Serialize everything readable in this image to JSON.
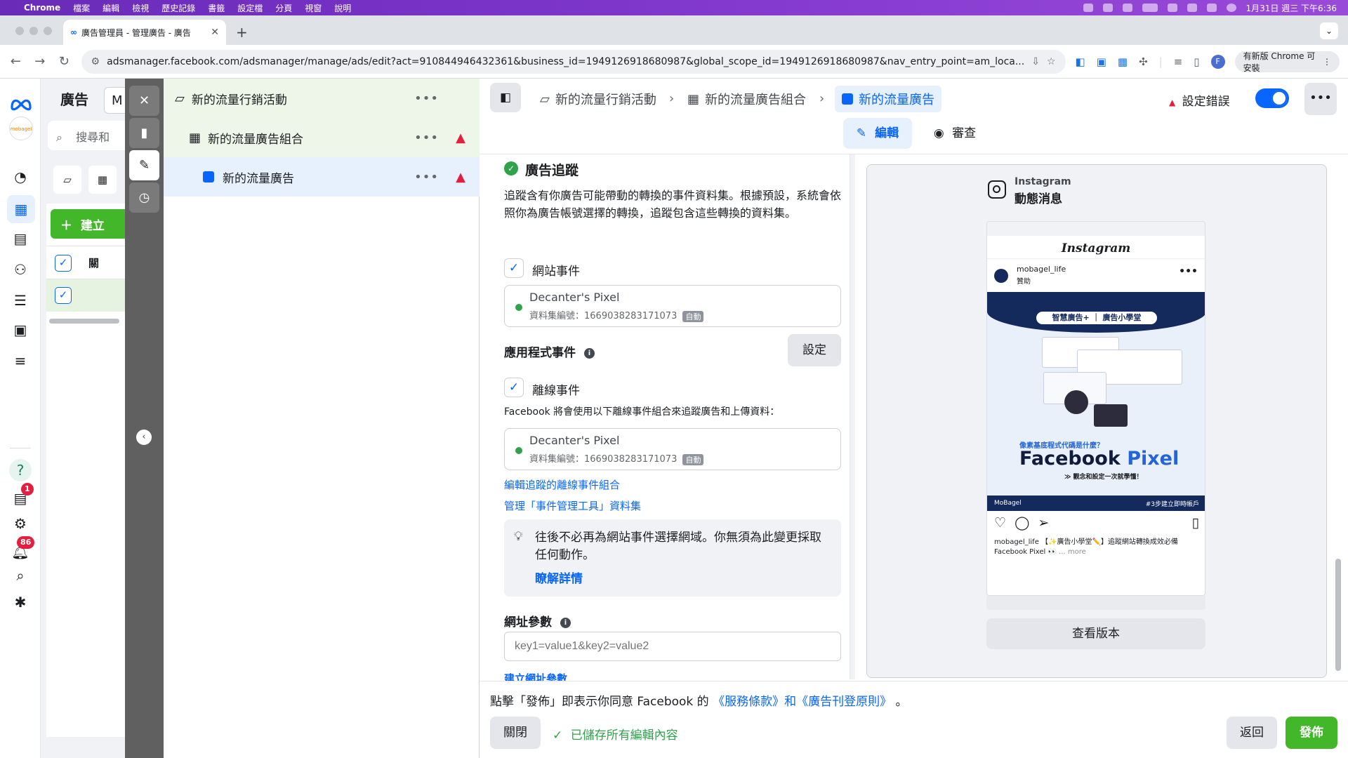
{
  "menubar": {
    "apple": "",
    "items": [
      "Chrome",
      "檔案",
      "編輯",
      "檢視",
      "歷史記錄",
      "書籤",
      "設定檔",
      "分頁",
      "視窗",
      "說明"
    ],
    "clock": "1月31日 週三 下午6:36"
  },
  "browser": {
    "tab_title": "廣告管理員 - 管理廣告 - 廣告",
    "url": "adsmanager.facebook.com/adsmanager/manage/ads/edit?act=910844946432361&business_id=1949126918680987&global_scope_id=1949126918680987&nav_entry_point=am_loca...",
    "update_label": "有新版 Chrome 可安裝",
    "profile_initial": "F"
  },
  "rail": {
    "help_glyph": "?",
    "notif_badge": "1",
    "alerts_badge": "86"
  },
  "under": {
    "title": "廣告",
    "search_placeholder": "搜尋和",
    "create_label": "建立",
    "col_header": "關",
    "partial_select": "M"
  },
  "tree": {
    "campaign": "新的流量行銷活動",
    "adset": "新的流量廣告組合",
    "ad": "新的流量廣告"
  },
  "header": {
    "crumb_campaign": "新的流量行銷活動",
    "crumb_adset": "新的流量廣告組合",
    "crumb_ad": "新的流量廣告",
    "error_label": "設定錯誤",
    "tab_edit": "編輯",
    "tab_review": "審查"
  },
  "tracking": {
    "section_title": "廣告追蹤",
    "description": "追蹤含有你廣告可能帶動的轉換的事件資料集。根據預設，系統會依照你為廣告帳號選擇的轉換，追蹤包含這些轉換的資料集。",
    "website_events": "網站事件",
    "pixel_name": "Decanter's Pixel",
    "dataset_id": "資料集編號：1669038283171073",
    "auto_tag": "自動",
    "app_events": "應用程式事件",
    "setup_btn": "設定",
    "offline_events": "離線事件",
    "offline_desc": "Facebook 將會使用以下離線事件組合來追蹤廣告和上傳資料：",
    "offline_pixel_name": "Decanter's Pixel",
    "offline_dataset_id": "資料集編號：1669038283171073",
    "offline_auto_tag": "自動",
    "edit_offline_link": "編輯追蹤的離線事件組合",
    "manage_link": "管理「事件管理工具」資料集",
    "notice": "往後不必再為網站事件選擇網域。你無須為此變更採取任何動作。",
    "learn_more": "瞭解詳情",
    "url_params": "網址參數",
    "url_placeholder": "key1=value1&key2=value2",
    "build_params_link": "建立網址參數"
  },
  "preview": {
    "platform": "Instagram",
    "placement": "動態消息",
    "ig_logo": "Instagram",
    "account": "mobagel_life",
    "sponsored": "贊助",
    "creative_pill": "智慧廣告+ ｜ 廣告小學堂",
    "creative_question": "像素基底程式代碼是什麼？",
    "creative_headline_a": "Facebook",
    "creative_headline_b": "Pixel",
    "creative_sub": "≫ 觀念和設定一次就學懂！",
    "creative_brand": "MoBagel",
    "creative_footer": "#3步建立即時帳戶",
    "caption": "mobagel_life 【✨廣告小學堂✏️】追蹤網站轉換成效必備 Facebook Pixel 👀",
    "more": "... more",
    "view_version": "查看版本"
  },
  "footer": {
    "agree_prefix": "點擊「發佈」即表示你同意 Facebook 的",
    "agree_links": "《服務條款》和《廣告刊登原則》",
    "agree_suffix": "。",
    "close_btn": "關閉",
    "saved_status": "已儲存所有編輯內容",
    "back_btn": "返回",
    "publish_btn": "發佈"
  },
  "colors": {
    "accent": "#0866ff",
    "success": "#42b72a",
    "error": "#e41e3f"
  }
}
